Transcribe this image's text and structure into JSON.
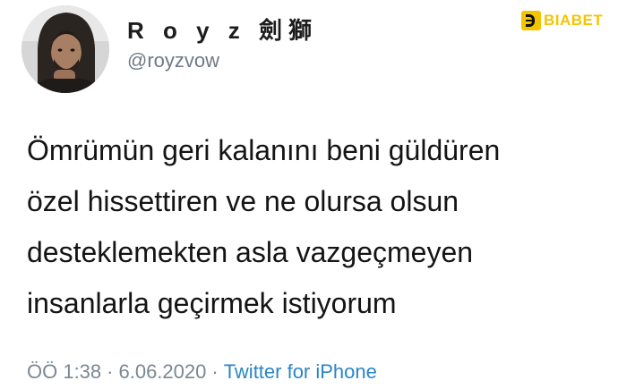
{
  "author": {
    "display_name": "R o y z 劍獅",
    "handle": "@royzvow"
  },
  "brand": {
    "name": "BIABET",
    "accent": "#f5c400"
  },
  "tweet": {
    "lines": [
      "Ömrümün geri kalanını beni güldüren",
      "özel hissettiren ve ne olursa olsun",
      "desteklemekten asla vazgeçmeyen",
      "insanlarla geçirmek istiyorum"
    ]
  },
  "meta": {
    "time": "ÖÖ 1:38",
    "separator": "·",
    "date": "6.06.2020",
    "source": "Twitter for iPhone"
  },
  "colors": {
    "handle": "#6e7a85",
    "link": "#2c86c4"
  }
}
